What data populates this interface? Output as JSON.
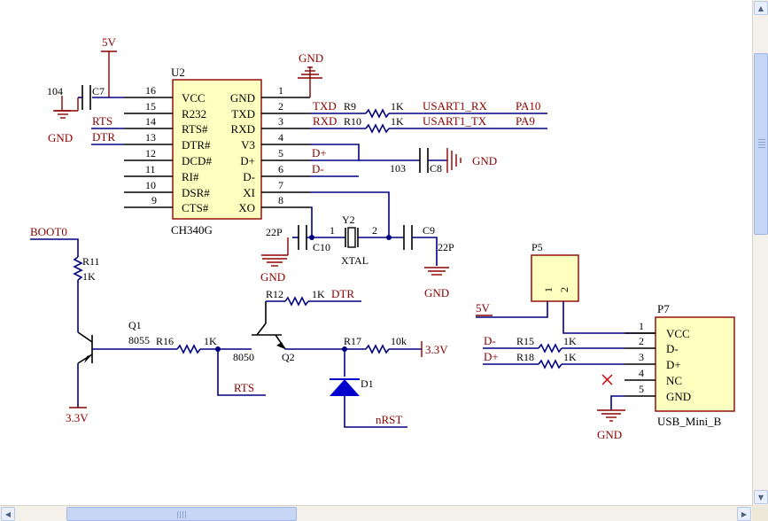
{
  "u2": {
    "designator": "U2",
    "part": "CH340G",
    "left_pins": [
      {
        "num": "16",
        "name": "VCC"
      },
      {
        "num": "15",
        "name": "R232"
      },
      {
        "num": "14",
        "name": "RTS#"
      },
      {
        "num": "13",
        "name": "DTR#"
      },
      {
        "num": "12",
        "name": "DCD#"
      },
      {
        "num": "11",
        "name": "RI#"
      },
      {
        "num": "10",
        "name": "DSR#"
      },
      {
        "num": "9",
        "name": "CTS#"
      }
    ],
    "right_pins": [
      {
        "num": "1",
        "name": "GND"
      },
      {
        "num": "2",
        "name": "TXD"
      },
      {
        "num": "3",
        "name": "RXD"
      },
      {
        "num": "4",
        "name": "V3"
      },
      {
        "num": "5",
        "name": "D+"
      },
      {
        "num": "6",
        "name": "D-"
      },
      {
        "num": "7",
        "name": "XI"
      },
      {
        "num": "8",
        "name": "XO"
      }
    ]
  },
  "power": {
    "v5": "5V",
    "gnd": "GND",
    "v33": "3.3V"
  },
  "c7": {
    "designator": "C7",
    "value": "104"
  },
  "c8": {
    "designator": "C8",
    "value": "103"
  },
  "c9": {
    "designator": "C9",
    "value": "22P"
  },
  "c10": {
    "designator": "C10",
    "value": "22P"
  },
  "y2": {
    "designator": "Y2",
    "value": "XTAL",
    "pin1": "1",
    "pin2": "2"
  },
  "r9": {
    "designator": "R9",
    "value": "1K"
  },
  "r10": {
    "designator": "R10",
    "value": "1K"
  },
  "r11": {
    "designator": "R11",
    "value": "1K"
  },
  "r12": {
    "designator": "R12",
    "value": "1K"
  },
  "r15": {
    "designator": "R15",
    "value": "1K"
  },
  "r16": {
    "designator": "R16",
    "value": "1K"
  },
  "r17": {
    "designator": "R17",
    "value": "10k"
  },
  "r18": {
    "designator": "R18",
    "value": "1K"
  },
  "q1": {
    "designator": "Q1",
    "part": "8055"
  },
  "q2": {
    "designator": "Q2",
    "part": "8050"
  },
  "d1": {
    "designator": "D1"
  },
  "nets": {
    "rts": "RTS",
    "dtr": "DTR",
    "txd": "TXD",
    "rxd": "RXD",
    "dplus": "D+",
    "dminus": "D-",
    "usart_rx": "USART1_RX",
    "usart_tx": "USART1_TX",
    "pa10": "PA10",
    "pa9": "PA9",
    "boot0": "BOOT0",
    "nrst": "nRST"
  },
  "p5": {
    "designator": "P5",
    "pin1": "1",
    "pin2": "2"
  },
  "p7": {
    "designator": "P7",
    "part": "USB_Mini_B",
    "pins": [
      {
        "num": "1",
        "name": "VCC"
      },
      {
        "num": "2",
        "name": "D-"
      },
      {
        "num": "3",
        "name": "D+"
      },
      {
        "num": "4",
        "name": "NC"
      },
      {
        "num": "5",
        "name": "GND"
      }
    ]
  },
  "scrollbars": {
    "up": "▲",
    "down": "▼",
    "left": "◀",
    "right": "▶"
  }
}
